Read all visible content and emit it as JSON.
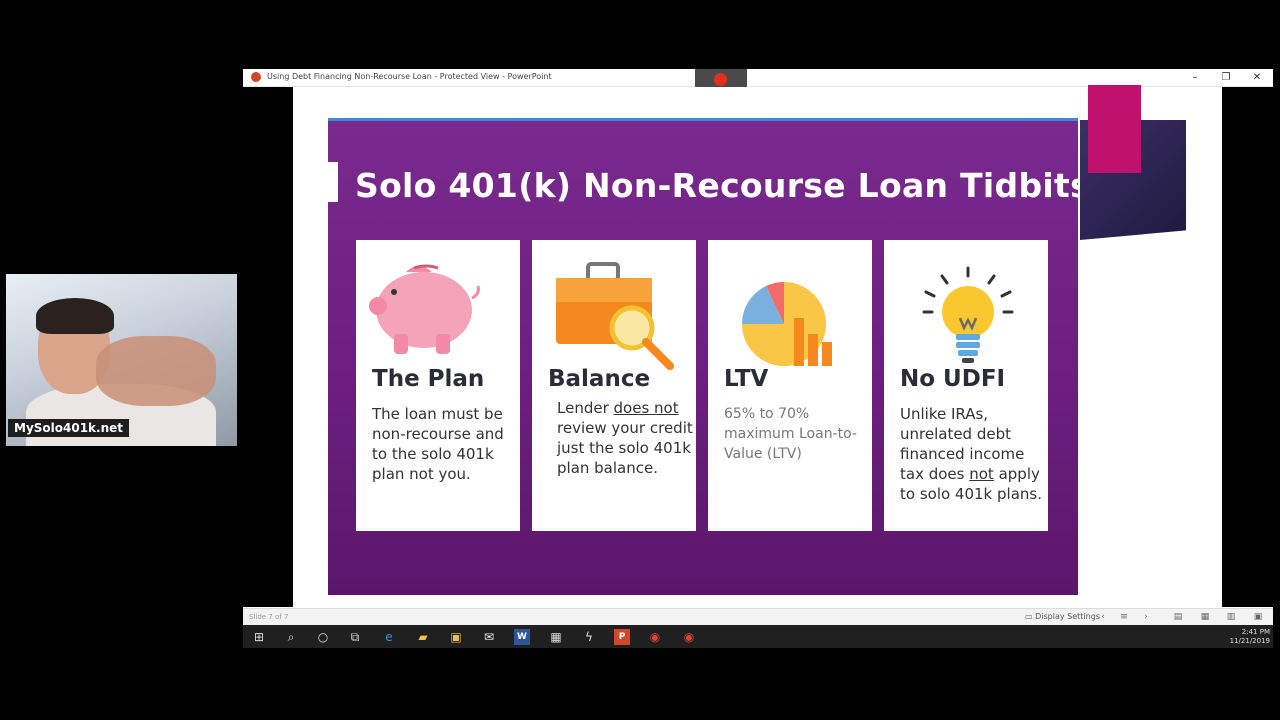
{
  "window": {
    "title": "Using Debt Financing Non-Recourse Loan  -  Protected View - PowerPoint",
    "minimize": "–",
    "restore": "❐",
    "close": "✕"
  },
  "slide": {
    "title": "Solo 401(k) Non-Recourse Loan Tidbits",
    "cards": [
      {
        "heading": "The Plan",
        "body": "The loan must be non-recourse and to the solo 401k plan not you.",
        "icon": "piggy-bank-icon"
      },
      {
        "heading": "Balance",
        "body_pre": "Lender ",
        "body_underline": "does not",
        "body_post": " review your credit just the solo 401k plan balance.",
        "icon": "briefcase-magnifier-icon"
      },
      {
        "heading": "LTV",
        "body": "65% to 70% maximum Loan-to-Value (LTV)",
        "icon": "pie-bar-chart-icon"
      },
      {
        "heading": "No UDFI",
        "body_pre": "Unlike IRAs, unrelated debt financed income tax does ",
        "body_underline": "not",
        "body_post": " apply to solo 401k plans.",
        "icon": "lightbulb-icon"
      }
    ],
    "colors": {
      "background": "#6c1f80",
      "accent_pink": "#c0116f",
      "accent_navy": "#2a2350",
      "top_line": "#3f8bd8"
    }
  },
  "statusbar": {
    "slide_number": "Slide 7 of 7",
    "display_settings": "Display Settings"
  },
  "taskbar": {
    "time": "2:41 PM",
    "date": "11/21/2019"
  },
  "webcam": {
    "label": "MySolo401k.net"
  }
}
